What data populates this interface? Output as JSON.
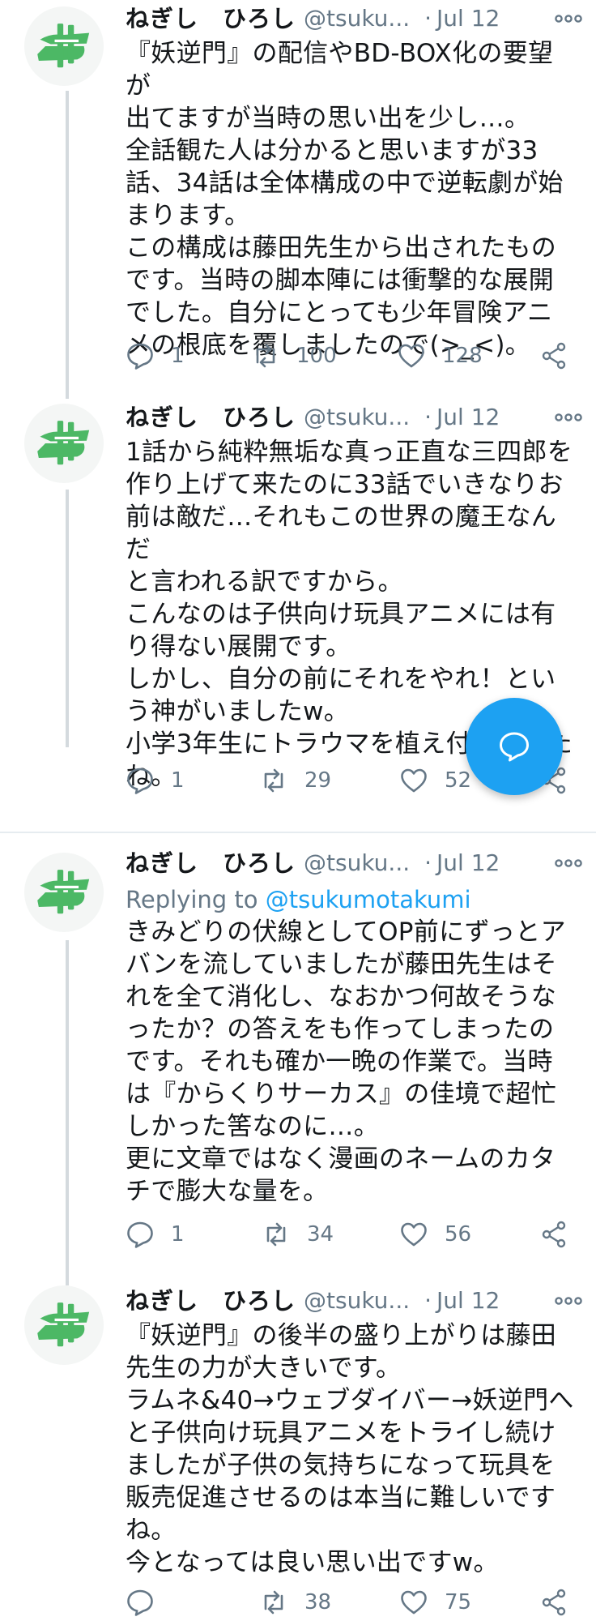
{
  "tweets": [
    {
      "name": "ねぎし　ひろし",
      "handle": "@tsuku...",
      "dot": "·",
      "date": "Jul 12",
      "body": "『妖逆門』の配信やBD-BOX化の要望が\n出てますが当時の思い出を少し…。\n全話観た人は分かると思いますが33\n話、34話は全体構成の中で逆転劇が始\nまります。\nこの構成は藤田先生から出されたもの\nです。当時の脚本陣には衝撃的な展開\nでした。自分にとっても少年冒険アニ\nメの根底を覆しましたので(>_<)。",
      "replies": "1",
      "retweets": "100",
      "likes": "128"
    },
    {
      "name": "ねぎし　ひろし",
      "handle": "@tsuku...",
      "dot": "·",
      "date": "Jul 12",
      "body": "1話から純粋無垢な真っ正直な三四郎を\n作り上げて来たのに33話でいきなりお\n前は敵だ…それもこの世界の魔王なんだ\nと言われる訳ですから。\nこんなのは子供向け玩具アニメには有\nり得ない展開です。\nしかし、自分の前にそれをやれ！とい\nう神がいましたw。\n小学3年生にトラウマを植え付けました\nね。",
      "replies": "1",
      "retweets": "29",
      "likes": "52"
    },
    {
      "name": "ねぎし　ひろし",
      "handle": "@tsuku...",
      "dot": "·",
      "date": "Jul 12",
      "replying_label": "Replying to",
      "replying_to": "@tsukumotakumi",
      "body": "きみどりの伏線としてOP前にずっとア\nバンを流していましたが藤田先生はそ\nれを全て消化し、なおかつ何故そうな\nったか？の答えをも作ってしまったの\nです。それも確か一晩の作業で。当時\nは『からくりサーカス』の佳境で超忙\nしかった筈なのに…。\n更に文章ではなく漫画のネームのカタ\nチで膨大な量を。",
      "replies": "1",
      "retweets": "34",
      "likes": "56"
    },
    {
      "name": "ねぎし　ひろし",
      "handle": "@tsuku...",
      "dot": "·",
      "date": "Jul 12",
      "body": "『妖逆門』の後半の盛り上がりは藤田\n先生の力が大きいです。\nラムネ&40→ウェブダイバー→妖逆門へ\nと子供向け玩具アニメをトライし続け\nましたが子供の気持ちになって玩具を\n販売促進させるのは本当に難しいです\nね。\n今となっては良い思い出ですw。",
      "replies": "",
      "retweets": "38",
      "likes": "75"
    }
  ],
  "icons": {
    "avatar": "green-logo-avatar",
    "more": "more-icon",
    "reply": "reply-icon",
    "retweet": "retweet-icon",
    "like": "like-icon",
    "share": "share-icon",
    "compose": "compose-fab-icon"
  },
  "colors": {
    "accent": "#1da1f2",
    "secondary_text": "#657786",
    "avatar_green": "#4cb865"
  }
}
